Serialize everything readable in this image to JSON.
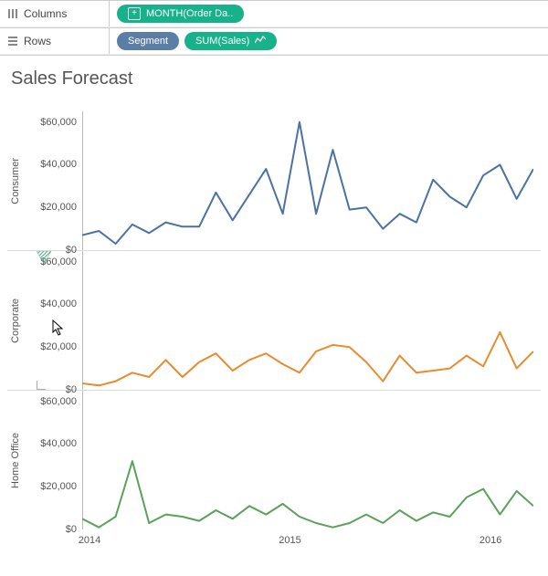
{
  "shelves": {
    "columns_label": "Columns",
    "rows_label": "Rows",
    "columns_pill": "MONTH(Order Da..",
    "rows_pill_segment": "Segment",
    "rows_pill_sales": "SUM(Sales)"
  },
  "title": "Sales Forecast",
  "y_ticks": [
    "$60,000",
    "$40,000",
    "$20,000",
    "$0"
  ],
  "x_ticks": [
    "2014",
    "2015",
    "2016"
  ],
  "segments": [
    "Consumer",
    "Corporate",
    "Home Office"
  ],
  "colors": {
    "Consumer": "#4a73a3",
    "Corporate": "#e98b2e",
    "Home Office": "#5aa25a"
  },
  "chart_data": {
    "type": "line",
    "title": "Sales Forecast",
    "xlabel": "",
    "ylabel": "",
    "ylim": [
      0,
      65000
    ],
    "x": [
      0,
      1,
      2,
      3,
      4,
      5,
      6,
      7,
      8,
      9,
      10,
      11,
      12,
      13,
      14,
      15,
      16,
      17,
      18,
      19,
      20,
      21,
      22,
      23,
      24,
      25,
      26,
      27
    ],
    "x_tick_positions": {
      "2014": 0,
      "2015": 12,
      "2016": 24
    },
    "facets": [
      "Consumer",
      "Corporate",
      "Home Office"
    ],
    "series": [
      {
        "name": "Consumer",
        "facet": "Consumer",
        "color": "#4a73a3",
        "values": [
          7000,
          9000,
          3000,
          12000,
          8000,
          13000,
          11000,
          11000,
          27000,
          14000,
          26000,
          38000,
          17000,
          60000,
          17000,
          47000,
          19000,
          20000,
          10000,
          17000,
          13000,
          33000,
          25000,
          20000,
          35000,
          40000,
          24000,
          38000
        ]
      },
      {
        "name": "Corporate",
        "facet": "Corporate",
        "color": "#e98b2e",
        "values": [
          3000,
          2000,
          4000,
          8000,
          6000,
          14000,
          6000,
          13000,
          17000,
          9000,
          14000,
          17000,
          12000,
          8000,
          18000,
          21000,
          20000,
          13000,
          4000,
          16000,
          8000,
          9000,
          10000,
          16000,
          11000,
          27000,
          10000,
          18000
        ]
      },
      {
        "name": "Home Office",
        "facet": "Home Office",
        "color": "#5aa25a",
        "values": [
          5000,
          1000,
          6000,
          32000,
          3000,
          7000,
          6000,
          4000,
          9000,
          5000,
          11000,
          7000,
          12000,
          6000,
          3000,
          1000,
          3000,
          7000,
          3000,
          9000,
          4000,
          8000,
          6000,
          15000,
          19000,
          7000,
          18000,
          11000
        ]
      }
    ]
  }
}
